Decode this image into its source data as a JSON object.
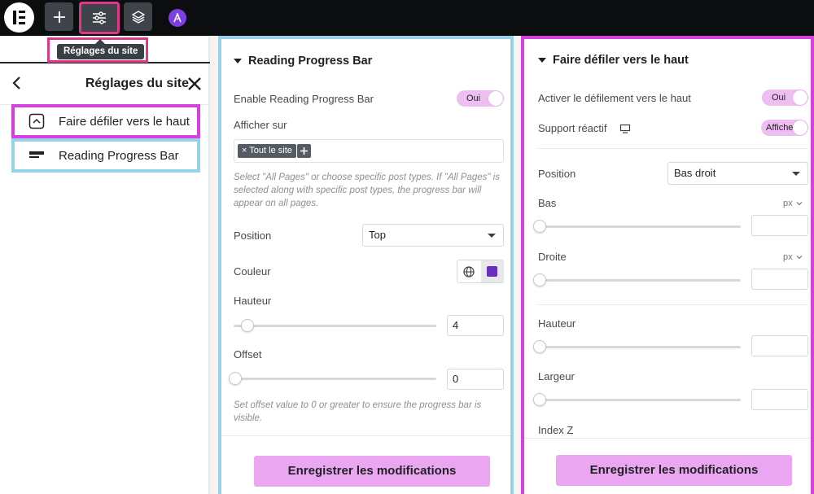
{
  "topbar": {
    "logo_icon": "elementor-logo-icon",
    "add_icon": "plus-icon",
    "settings_icon": "sliders-icon",
    "layers_icon": "layers-icon",
    "astra_icon": "astra-icon",
    "tooltip": "Réglages du site"
  },
  "sidebar": {
    "title": "Réglages du site",
    "items": [
      {
        "label": "Faire défiler vers le haut",
        "icon": "scroll-top-icon"
      },
      {
        "label": "Reading Progress Bar",
        "icon": "progress-bar-icon"
      }
    ]
  },
  "progress_panel": {
    "title": "Reading Progress Bar",
    "enable_label": "Enable Reading Progress Bar",
    "enable_value": "Oui",
    "display_on_label": "Afficher sur",
    "display_on_tag": "Tout le site",
    "display_help": "Select \"All Pages\" or choose specific post types. If \"All Pages\" is selected along with specific post types, the progress bar will appear on all pages.",
    "position_label": "Position",
    "position_value": "Top",
    "color_label": "Couleur",
    "color_swatch": "#6b2fc0",
    "height_label": "Hauteur",
    "height_value": "4",
    "height_slider": 0.06,
    "offset_label": "Offset",
    "offset_value": "0",
    "offset_slider": 0,
    "offset_help": "Set offset value to 0 or greater to ensure the progress bar is visible.",
    "save_label": "Enregistrer les modifications"
  },
  "scroll_panel": {
    "title": "Faire défiler vers le haut",
    "enable_label": "Activer le défilement vers le haut",
    "enable_value": "Oui",
    "responsive_label": "Support réactif",
    "responsive_value": "Affiche",
    "position_label": "Position",
    "position_value": "Bas droit",
    "bottom_label": "Bas",
    "bottom_unit": "px",
    "right_label": "Droite",
    "right_unit": "px",
    "height_label": "Hauteur",
    "width_label": "Largeur",
    "zindex_label": "Index Z",
    "save_label": "Enregistrer les modifications"
  }
}
